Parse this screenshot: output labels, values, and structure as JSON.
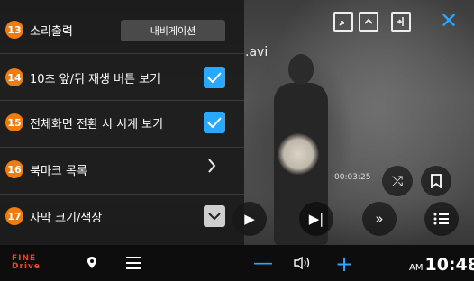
{
  "video": {
    "filename": ".avi",
    "current_time": "00:03:25"
  },
  "top_controls": {
    "icons": [
      "resize-icon",
      "collapse-up-icon",
      "exit-fullscreen-icon",
      "close-icon"
    ],
    "accent_color": "#29a8ff"
  },
  "settings": {
    "sound_output": {
      "badge": "13",
      "label": "소리출력",
      "button": "내비게이션"
    },
    "skip_buttons": {
      "badge": "14",
      "label": "10초 앞/뒤 재생 버튼 보기",
      "checked": true
    },
    "clock_fullscreen": {
      "badge": "15",
      "label": "전체화면 전환 시 시계 보기",
      "checked": true
    },
    "bookmarks": {
      "badge": "16",
      "label": "북마크 목록"
    },
    "subtitle": {
      "badge": "17",
      "label": "자막 크기/색상"
    }
  },
  "bottom_bar": {
    "logo_line1": "FINE",
    "logo_line2": "Drive",
    "clock_ampm": "AM",
    "clock_time": "10:48"
  },
  "colors": {
    "badge": "#f07c10",
    "check": "#28a8ff",
    "logo": "#e24b24"
  }
}
